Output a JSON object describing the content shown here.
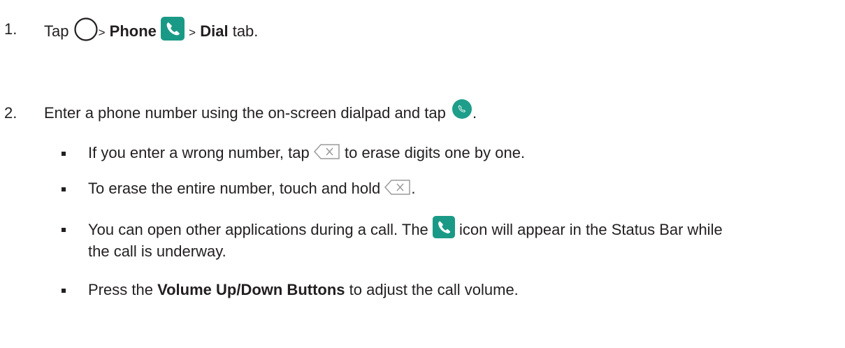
{
  "step1": {
    "number": "1.",
    "tap": "Tap",
    "sep1": ">",
    "phone": "Phone",
    "sep2": ">",
    "dial": "Dial",
    "tab": "tab."
  },
  "step2": {
    "number": "2.",
    "text": "Enter a phone number using the on-screen dialpad and tap",
    "end": "."
  },
  "bullets": {
    "b1_pre": "If you enter a wrong number, tap",
    "b1_post": "to erase digits one by one.",
    "b2_pre": "To erase the entire number, touch and hold",
    "b2_post": ".",
    "b3_pre": "You can open other applications during a call. The",
    "b3_post": "icon will appear in the Status Bar while",
    "b3_line2": "the call is underway.",
    "b4_pre": "Press the",
    "b4_bold": "Volume Up/Down Buttons",
    "b4_post": "to adjust the call volume."
  },
  "icons": {
    "home": "home-circle-icon",
    "phone_app": "phone-app-icon",
    "call_button": "call-button-icon",
    "backspace": "backspace-icon"
  },
  "colors": {
    "phone_green": "#1a9a86",
    "call_teal": "#1e9e8a",
    "text": "#231f20"
  }
}
